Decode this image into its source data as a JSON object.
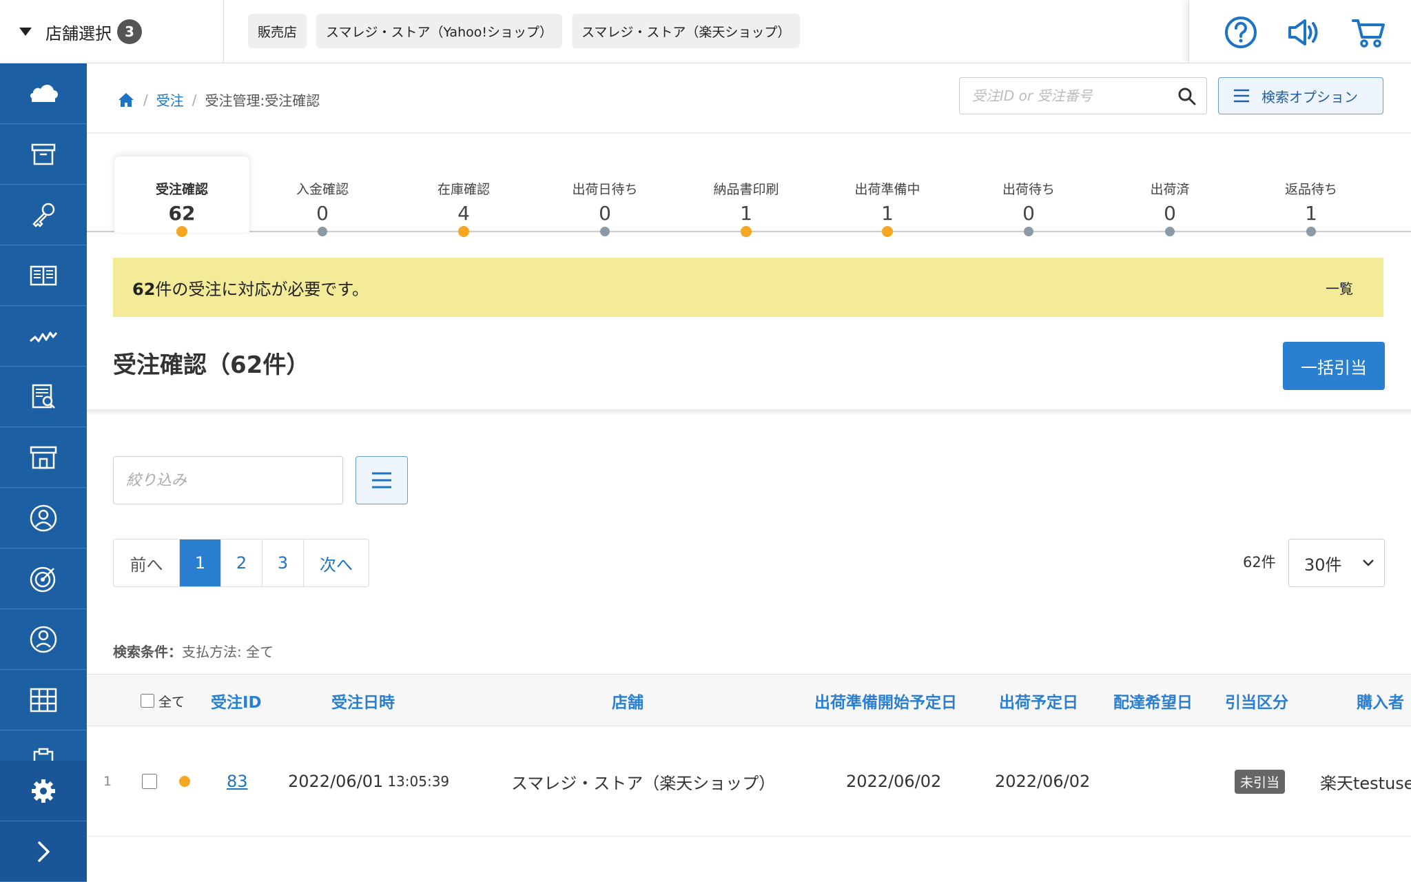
{
  "topbar": {
    "store_select_label": "店舗選択",
    "store_count": "3",
    "chips": [
      "販売店",
      "スマレジ・ストア（Yahoo!ショップ）",
      "スマレジ・ストア（楽天ショップ）"
    ],
    "icons": [
      "help-icon",
      "megaphone-icon",
      "cart-icon"
    ]
  },
  "sidebar": {
    "items": [
      "cloud-icon",
      "archive-box-icon",
      "key-icon",
      "book-icon",
      "chart-line-icon",
      "report-search-icon",
      "store-icon",
      "user-circle-icon",
      "target-icon",
      "customer-icon",
      "grid-icon",
      "clipboard-icon"
    ],
    "bottom": [
      "gear-icon",
      "chevron-right-icon"
    ]
  },
  "breadcrumb": {
    "home_icon": "home-icon",
    "parent": "受注",
    "current": "受注管理:受注確認"
  },
  "search": {
    "placeholder": "受注ID or 受注番号",
    "options_label": "検索オプション"
  },
  "steps": [
    {
      "name": "受注確認",
      "count": "62",
      "status": "orange",
      "active": true
    },
    {
      "name": "入金確認",
      "count": "0",
      "status": "gray"
    },
    {
      "name": "在庫確認",
      "count": "4",
      "status": "orange"
    },
    {
      "name": "出荷日待ち",
      "count": "0",
      "status": "gray"
    },
    {
      "name": "納品書印刷",
      "count": "1",
      "status": "orange"
    },
    {
      "name": "出荷準備中",
      "count": "1",
      "status": "orange"
    },
    {
      "name": "出荷待ち",
      "count": "0",
      "status": "gray"
    },
    {
      "name": "出荷済",
      "count": "0",
      "status": "gray"
    },
    {
      "name": "返品待ち",
      "count": "1",
      "status": "gray"
    }
  ],
  "alert": {
    "count": "62",
    "message": "件の受注に対応が必要です。",
    "link": "一覧"
  },
  "page": {
    "title": "受注確認（62件）",
    "bulk_button": "一括引当",
    "filter_placeholder": "絞り込み"
  },
  "pager": {
    "prev": "前へ",
    "pages": [
      "1",
      "2",
      "3"
    ],
    "current": "1",
    "next": "次へ",
    "total": "62件",
    "per_page": "30件"
  },
  "conditions": {
    "label": "検索条件：",
    "value": "支払方法: 全て"
  },
  "table": {
    "all_label": "全て",
    "headers": [
      "受注ID",
      "受注日時",
      "店舗",
      "出荷準備開始予定日",
      "出荷予定日",
      "配達希望日",
      "引当区分",
      "購入者"
    ],
    "rows": [
      {
        "index": "1",
        "order_id": "83",
        "date": "2022/06/01",
        "time": "13:05:39",
        "store": "スマレジ・ストア（楽天ショップ）",
        "prep_date": "2022/06/02",
        "ship_date": "2022/06/02",
        "delivery_date": "",
        "allocation": "未引当",
        "buyer": "楽天testuse"
      }
    ]
  },
  "colors": {
    "sidebar": "#1d5fa3",
    "accent": "#2b7fd1",
    "status_orange": "#f5a623",
    "alert_bg": "#f3eb97"
  }
}
